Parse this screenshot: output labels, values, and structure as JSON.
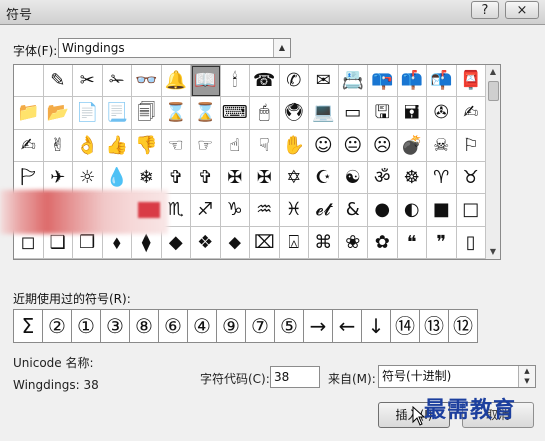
{
  "window": {
    "title": "符号",
    "help_label": "?",
    "close_label": "×"
  },
  "font": {
    "label": "字体(F):",
    "value": "Wingdings"
  },
  "symbols": [
    "",
    "✎",
    "✂",
    "✁",
    "👓",
    "🔔",
    "📖",
    "🕯",
    "☎",
    "✆",
    "✉",
    "📇",
    "📪",
    "📫",
    "📬",
    "📮",
    "📁",
    "📂",
    "📄",
    "📃",
    "🗐",
    "⌛",
    "⌛",
    "⌨",
    "🖱",
    "🖲",
    "💻",
    "▭",
    "🖫",
    "🖬",
    "✇",
    "✍",
    "✍",
    "✌",
    "👌",
    "👍",
    "👎",
    "☜",
    "☞",
    "☝",
    "☟",
    "✋",
    "☺",
    "😐",
    "☹",
    "💣",
    "☠",
    "⚐",
    "🏱",
    "✈",
    "☼",
    "💧",
    "❄",
    "✞",
    "✞",
    "✠",
    "✠",
    "✡",
    "☪",
    "☯",
    "ॐ",
    "☸",
    "♈",
    "♉",
    "♊",
    "♋",
    "♌",
    "♍",
    "♎",
    "♏",
    "♐",
    "♑",
    "♒",
    "♓",
    "𝓮𝓽",
    "&",
    "●",
    "◐",
    "■",
    "□",
    "◻",
    "❑",
    "❒",
    "⬧",
    "⧫",
    "◆",
    "❖",
    "⬥",
    "⌧",
    "⍓",
    "⌘",
    "❀",
    "✿",
    "❝",
    "❞",
    "▯"
  ],
  "recent": {
    "label": "近期使用过的符号(R):",
    "symbols": [
      "Σ",
      "②",
      "①",
      "③",
      "⑧",
      "⑥",
      "④",
      "⑨",
      "⑦",
      "⑤",
      "→",
      "←",
      "↓",
      "⑭",
      "⑬",
      "⑫"
    ]
  },
  "unicode_name_label": "Unicode 名称:",
  "char_desc": "Wingdings: 38",
  "char_code": {
    "label": "字符代码(C):",
    "value": "38"
  },
  "from": {
    "label": "来自(M):",
    "value": "符号(十进制)"
  },
  "buttons": {
    "insert": "插入(I)",
    "cancel": "取消"
  },
  "watermark": "最需教育"
}
